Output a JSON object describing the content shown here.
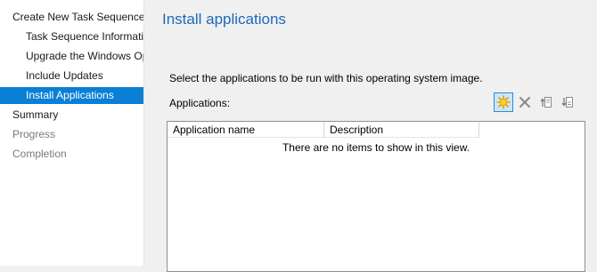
{
  "nav": {
    "items": [
      {
        "label": "Create New Task Sequence",
        "level": 0,
        "state": "normal"
      },
      {
        "label": "Task Sequence Information",
        "level": 1,
        "state": "normal"
      },
      {
        "label": "Upgrade the Windows Operating System",
        "level": 1,
        "state": "normal"
      },
      {
        "label": "Include Updates",
        "level": 1,
        "state": "normal"
      },
      {
        "label": "Install Applications",
        "level": 1,
        "state": "selected"
      },
      {
        "label": "Summary",
        "level": 0,
        "state": "normal"
      },
      {
        "label": "Progress",
        "level": 0,
        "state": "disabled"
      },
      {
        "label": "Completion",
        "level": 0,
        "state": "disabled"
      }
    ]
  },
  "page": {
    "title": "Install applications",
    "instruction": "Select the applications to be run with this operating system image.",
    "apps_label": "Applications:"
  },
  "toolbar": {
    "buttons": [
      {
        "icon": "new-starburst-icon",
        "state": "active"
      },
      {
        "icon": "delete-x-icon",
        "state": "normal"
      },
      {
        "icon": "move-up-icon",
        "state": "normal"
      },
      {
        "icon": "move-down-icon",
        "state": "normal"
      }
    ]
  },
  "list": {
    "columns": [
      "Application name",
      "Description"
    ],
    "empty_text": "There are no items to show in this view."
  },
  "colors": {
    "selected_bg": "#0a7fd6",
    "title": "#1e68b8",
    "toolbar_active": "#cde6f7"
  }
}
